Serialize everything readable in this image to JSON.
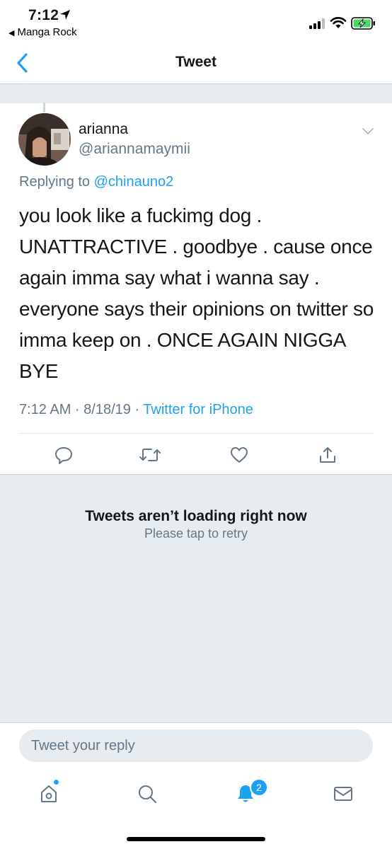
{
  "status_bar": {
    "time": "7:12",
    "back_app": "Manga Rock"
  },
  "nav": {
    "title": "Tweet"
  },
  "tweet": {
    "display_name": "arianna",
    "handle": "@ariannamaymii",
    "replying_prefix": "Replying to ",
    "replying_to": "@chinauno2",
    "text": "you look like a fuckimg dog . UNATTRACTIVE . goodbye . cause once again imma say what i wanna say . everyone says their opinions on twitter so imma keep on . ONCE AGAIN NIGGA BYE",
    "timestamp": "7:12 AM · 8/18/19 · ",
    "source": "Twitter for iPhone"
  },
  "error": {
    "title": "Tweets aren’t loading right now",
    "subtitle": "Please tap to retry"
  },
  "reply": {
    "placeholder": "Tweet your reply"
  },
  "tab_bar": {
    "notification_count": "2"
  },
  "icons": {
    "accent": "#1da1f2",
    "muted": "#657786",
    "battery": "#4cd964"
  }
}
